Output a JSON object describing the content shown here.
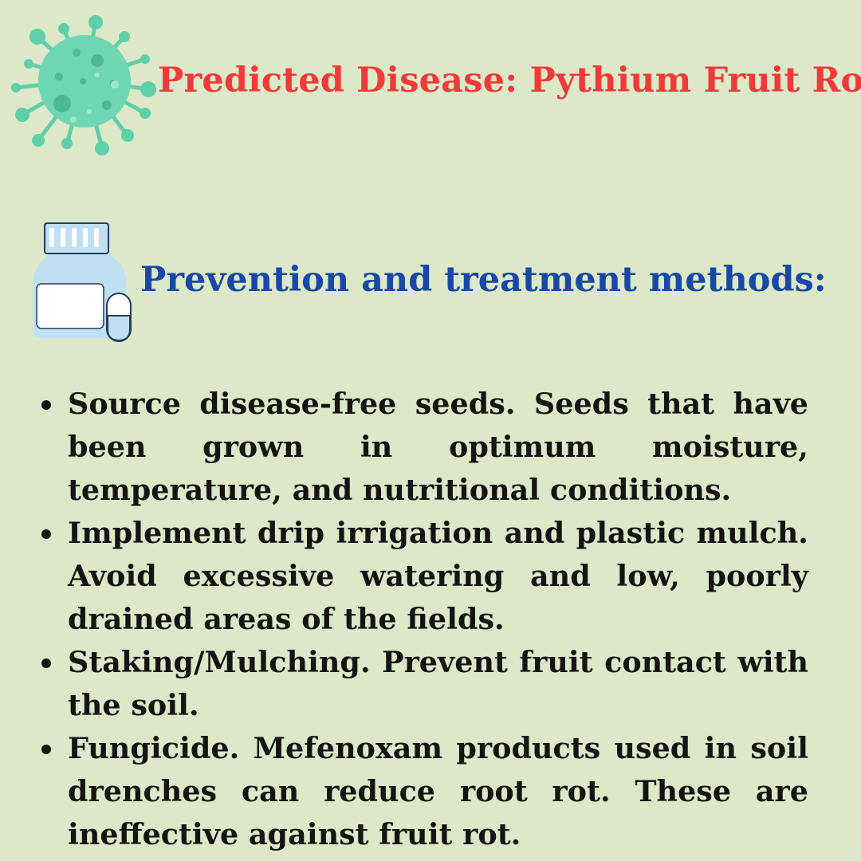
{
  "header": {
    "title": "Predicted Disease: Pythium Fruit Rot",
    "title_color": "#f03a37",
    "icon": "virus-icon"
  },
  "section": {
    "heading": "Prevention and treatment methods:",
    "heading_color": "#1748a6",
    "icon": "medicine-bottle-icon"
  },
  "methods": [
    {
      "text": "Source disease-free seeds. Seeds that have been grown in optimum moisture, temperature, and nutritional conditions."
    },
    {
      "text": "Implement drip irrigation and plastic mulch. Avoid excessive watering and low, poorly drained areas of the fields."
    },
    {
      "text": "Staking/Mulching. Prevent fruit contact with the soil."
    },
    {
      "text": "Fungicide. Mefenoxam products used in soil drenches can reduce root rot. These are ineffective against fruit rot."
    }
  ],
  "colors": {
    "background": "#dce8c8",
    "text": "#141414",
    "virus": "#5fcfaa",
    "bottle": "#bfe0f2"
  }
}
